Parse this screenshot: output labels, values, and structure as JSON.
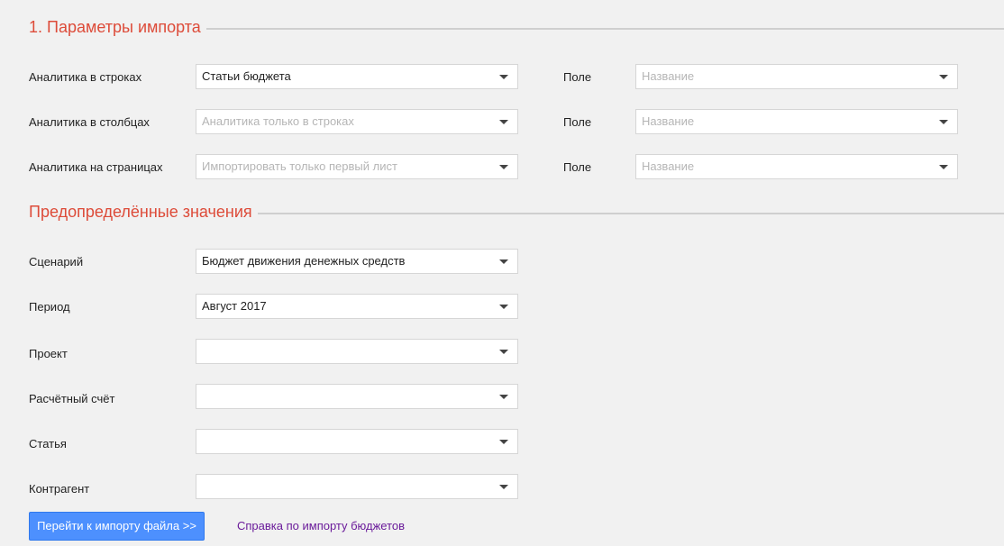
{
  "section1": {
    "title": "1. Параметры импорта",
    "rows": [
      {
        "label": "Аналитика в строках",
        "value": "Статьи бюджета",
        "placeholder": "",
        "field_label": "Поле",
        "field_placeholder": "Название"
      },
      {
        "label": "Аналитика в столбцах",
        "value": "",
        "placeholder": "Аналитика только в строках",
        "field_label": "Поле",
        "field_placeholder": "Название"
      },
      {
        "label": "Аналитика на страницах",
        "value": "",
        "placeholder": "Импортировать только первый лист",
        "field_label": "Поле",
        "field_placeholder": "Название"
      }
    ]
  },
  "section2": {
    "title": "Предопределённые значения",
    "rows": [
      {
        "label": "Сценарий",
        "value": "Бюджет движения денежных средств"
      },
      {
        "label": "Период",
        "value": "Август 2017"
      },
      {
        "label": "Проект",
        "value": ""
      },
      {
        "label": "Расчётный счёт",
        "value": ""
      },
      {
        "label": "Статья",
        "value": ""
      },
      {
        "label": "Контрагент",
        "value": ""
      }
    ]
  },
  "actions": {
    "next_button": "Перейти к импорту файла >>",
    "help_link": "Справка по импорту бюджетов"
  },
  "colors": {
    "section_title": "#dd4b39",
    "primary_button": "#4d90fe",
    "link": "#6a1b9a"
  },
  "icons": {
    "dropdown": "chevron-down-icon"
  }
}
